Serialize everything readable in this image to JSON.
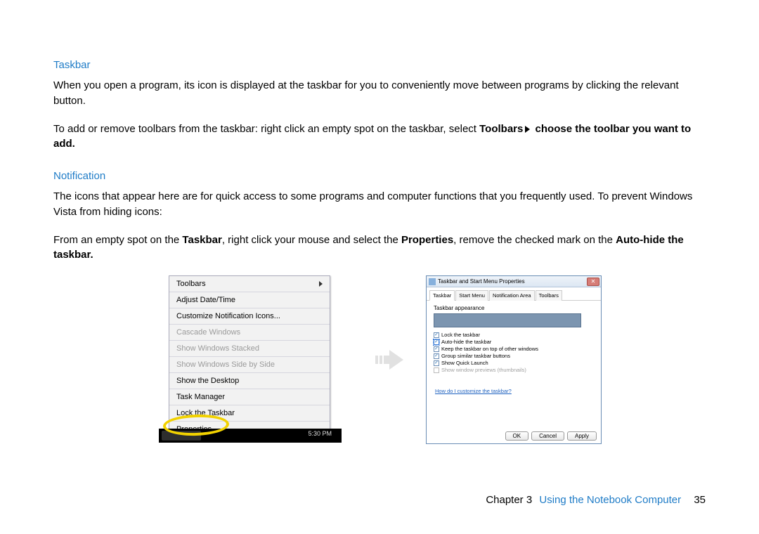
{
  "sections": {
    "taskbar": {
      "heading": "Taskbar",
      "p1": "When you open a program, its icon is displayed at the taskbar for you to conveniently move between programs by clicking the relevant button.",
      "p2a": "To add or remove toolbars from the taskbar: right click an empty spot on the taskbar, select ",
      "p2_bold1": "Toolbars",
      "p2_bold2": " choose the toolbar you want to add."
    },
    "notification": {
      "heading": "Notification",
      "p1": "The icons that appear here are for quick access to some programs and computer functions that you frequently used. To prevent Windows Vista from hiding icons:",
      "p2a": "From an empty spot on the ",
      "p2b": "Taskbar",
      "p2c": ", right click your mouse and select the ",
      "p2d": "Properties",
      "p2e": ", remove the checked mark on the ",
      "p2f": "Auto-hide the taskbar."
    }
  },
  "contextMenu": {
    "items": [
      {
        "label": "Toolbars",
        "hasSubmenu": true,
        "disabled": false
      },
      {
        "label": "Adjust Date/Time",
        "hasSubmenu": false,
        "disabled": false
      },
      {
        "label": "Customize Notification Icons...",
        "hasSubmenu": false,
        "disabled": false
      },
      {
        "label": "Cascade Windows",
        "hasSubmenu": false,
        "disabled": true
      },
      {
        "label": "Show Windows Stacked",
        "hasSubmenu": false,
        "disabled": true
      },
      {
        "label": "Show Windows Side by Side",
        "hasSubmenu": false,
        "disabled": true
      },
      {
        "label": "Show the Desktop",
        "hasSubmenu": false,
        "disabled": false
      },
      {
        "label": "Task Manager",
        "hasSubmenu": false,
        "disabled": false
      },
      {
        "label": "Lock the Taskbar",
        "hasSubmenu": false,
        "disabled": false
      },
      {
        "label": "Properties",
        "hasSubmenu": false,
        "disabled": false
      }
    ],
    "taskbarTime": "5:30 PM"
  },
  "dialog": {
    "title": "Taskbar and Start Menu Properties",
    "tabs": [
      "Taskbar",
      "Start Menu",
      "Notification Area",
      "Toolbars"
    ],
    "groupLabel": "Taskbar appearance",
    "checkboxes": [
      {
        "label": "Lock the taskbar",
        "checked": true,
        "highlight": false,
        "disabled": false
      },
      {
        "label": "Auto-hide the taskbar",
        "checked": true,
        "highlight": true,
        "disabled": false
      },
      {
        "label": "Keep the taskbar on top of other windows",
        "checked": true,
        "highlight": false,
        "disabled": false
      },
      {
        "label": "Group similar taskbar buttons",
        "checked": true,
        "highlight": false,
        "disabled": false
      },
      {
        "label": "Show Quick Launch",
        "checked": true,
        "highlight": false,
        "disabled": false
      },
      {
        "label": "Show window previews (thumbnails)",
        "checked": false,
        "highlight": false,
        "disabled": true
      }
    ],
    "link": "How do I customize the taskbar?",
    "buttons": {
      "ok": "OK",
      "cancel": "Cancel",
      "apply": "Apply"
    },
    "closeGlyph": "✕"
  },
  "footer": {
    "chapter": "Chapter 3",
    "title": "Using the Notebook Computer",
    "page": "35"
  }
}
